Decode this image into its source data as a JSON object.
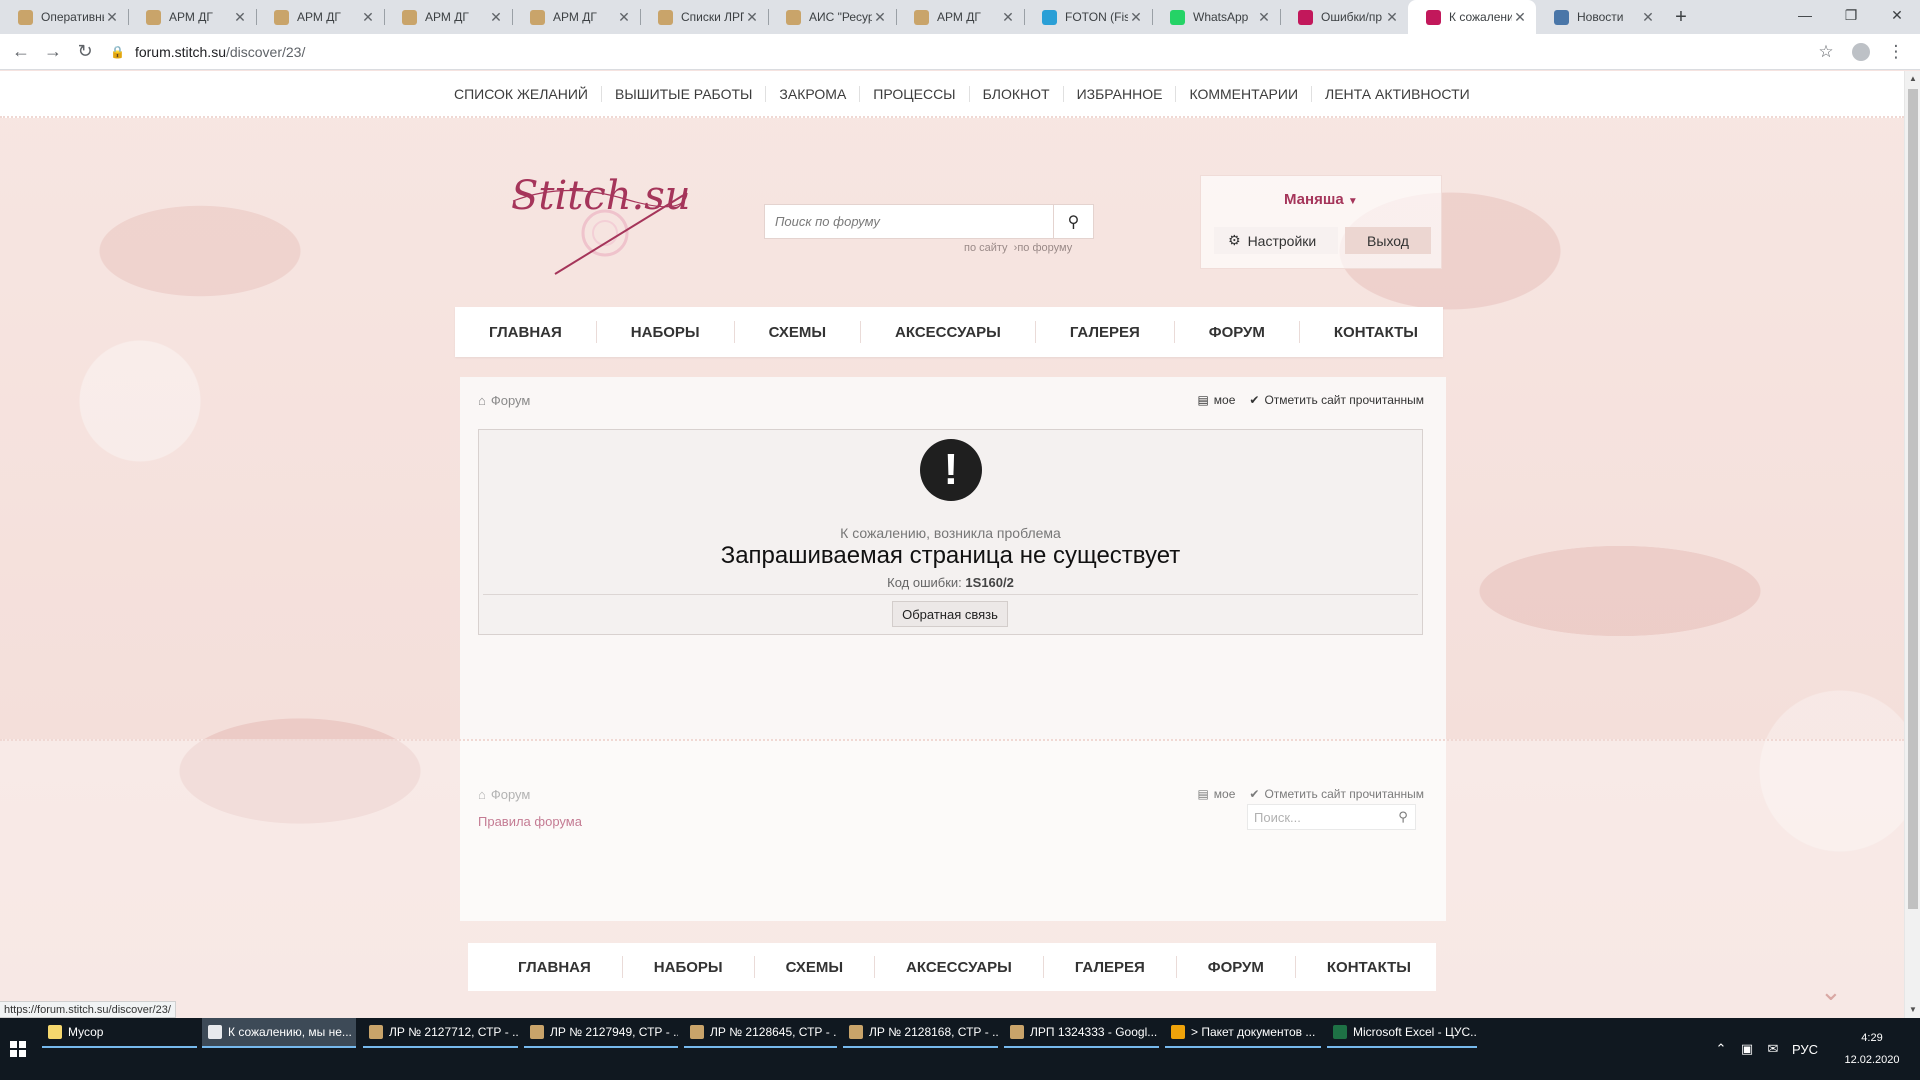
{
  "browser": {
    "tabs": [
      {
        "label": "Оперативны",
        "color": "#c9a46a"
      },
      {
        "label": "АРМ ДГ",
        "color": "#c9a46a"
      },
      {
        "label": "АРМ ДГ",
        "color": "#c9a46a"
      },
      {
        "label": "АРМ ДГ",
        "color": "#c9a46a"
      },
      {
        "label": "АРМ ДГ",
        "color": "#c9a46a"
      },
      {
        "label": "Списки ЛРП",
        "color": "#c9a46a"
      },
      {
        "label": "АИС \"Ресур",
        "color": "#c9a46a"
      },
      {
        "label": "АРМ ДГ",
        "color": "#c9a46a"
      },
      {
        "label": "FOTON (Fish",
        "color": "#2a9fd6"
      },
      {
        "label": "WhatsApp",
        "color": "#25d366"
      },
      {
        "label": "Ошибки/пр",
        "color": "#c2185b"
      },
      {
        "label": "К сожалени",
        "color": "#c2185b"
      },
      {
        "label": "Новости",
        "color": "#4a76a8"
      }
    ],
    "url_host": "forum.stitch.su",
    "url_path": "/discover/23/",
    "status_url": "https://forum.stitch.su/discover/23/"
  },
  "top_menu": [
    "Список желаний",
    "Вышитые работы",
    "Закрома",
    "Процессы",
    "Блокнот",
    "Избранное",
    "Комментарии",
    "Лента активности"
  ],
  "logo_text": "Stitch.su",
  "search": {
    "placeholder": "Поиск по форуму",
    "scope_site": "по сайту",
    "scope_forum": "по форуму"
  },
  "user": {
    "name": "Маняша",
    "settings_label": "Настройки",
    "logout_label": "Выход"
  },
  "main_nav": [
    "ГЛАВНАЯ",
    "НАБОРЫ",
    "СХЕМЫ",
    "АКСЕССУАРЫ",
    "ГАЛЕРЕЯ",
    "ФОРУМ",
    "КОНТАКТЫ"
  ],
  "breadcrumb": {
    "forum": "Форум",
    "mine": "мое",
    "mark_read": "Отметить сайт прочитанным"
  },
  "error": {
    "sorry": "К сожалению, возникла проблема",
    "title": "Запрашиваемая страница не существует",
    "code_label": "Код ошибки:",
    "code": "1S160/2",
    "feedback_label": "Обратная связь"
  },
  "forum_rules": "Правила форума",
  "mini_search_placeholder": "Поиск...",
  "taskbar": {
    "items": [
      {
        "label": "Мусор",
        "color": "#f5d76e"
      },
      {
        "label": "К сожалению, мы не...",
        "color": "#e8eaed"
      },
      {
        "label": "ЛР № 2127712, СТР - ...",
        "color": "#c9a46a"
      },
      {
        "label": "ЛР № 2127949, СТР - ...",
        "color": "#c9a46a"
      },
      {
        "label": "ЛР № 2128645, СТР - ...",
        "color": "#c9a46a"
      },
      {
        "label": "ЛР № 2128168, СТР - ...",
        "color": "#c9a46a"
      },
      {
        "label": "ЛРП 1324333 - Googl...",
        "color": "#c9a46a"
      },
      {
        "label": "> Пакет документов ...",
        "color": "#f0a30a"
      },
      {
        "label": "Microsoft Excel - ЦУС...",
        "color": "#1e7145"
      }
    ],
    "lang": "РУС",
    "time": "4:29",
    "date": "12.02.2020"
  }
}
